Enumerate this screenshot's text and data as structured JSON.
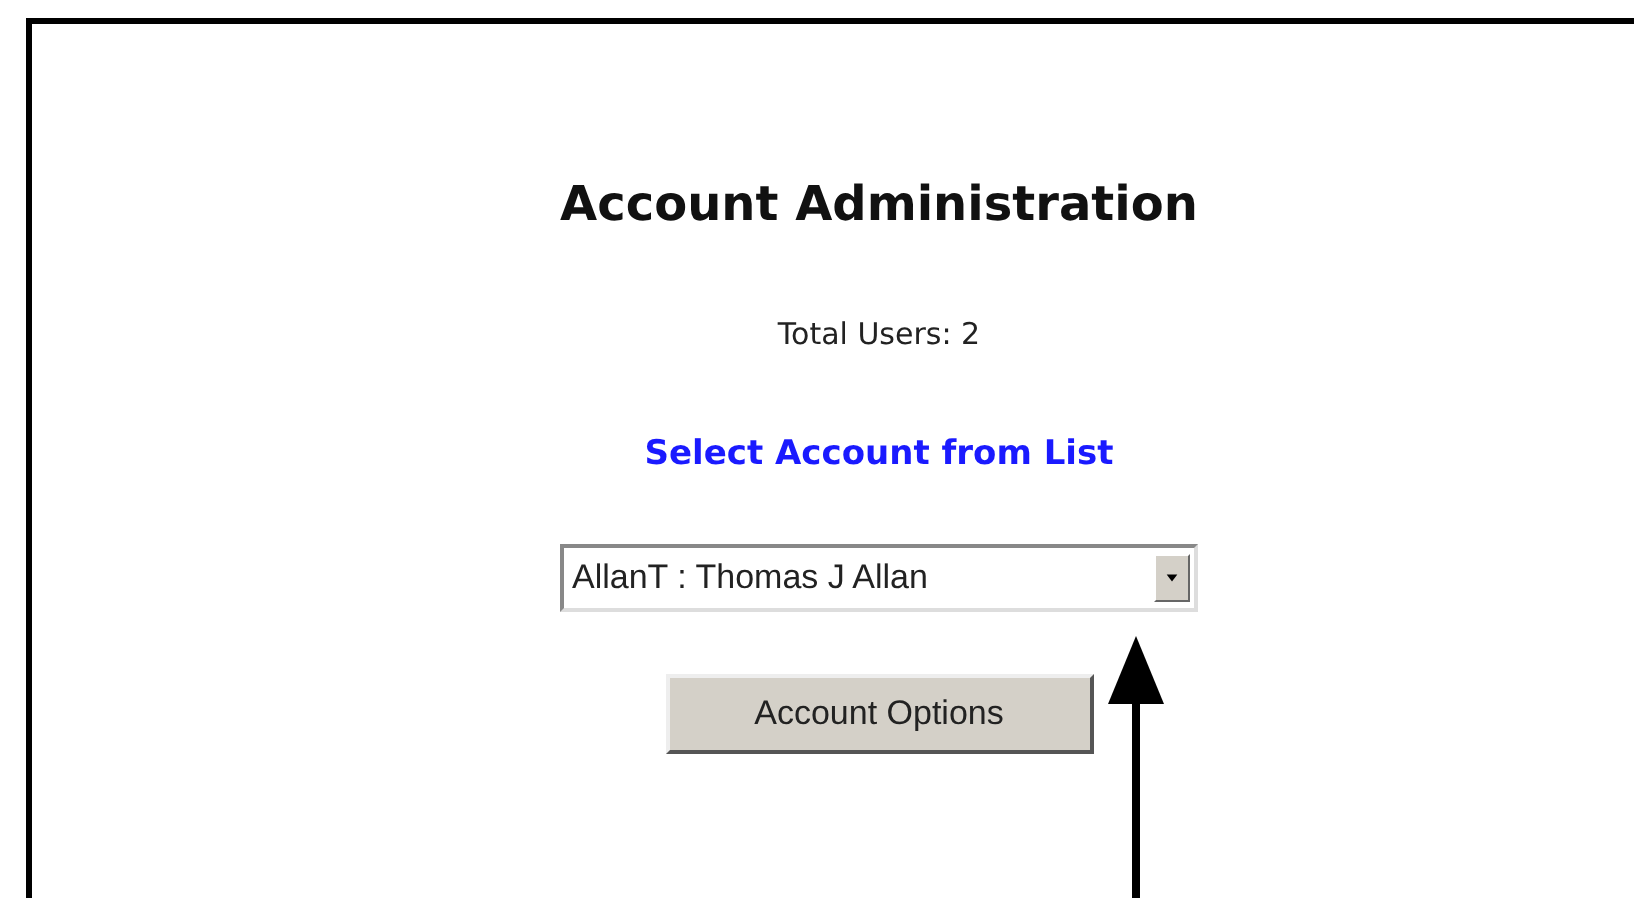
{
  "title": "Account Administration",
  "total_users": "Total Users: 2",
  "select_prompt": "Select Account from List",
  "account_select": {
    "value": "AllanT : Thomas J Allan"
  },
  "buttons": [
    "Account Options"
  ]
}
